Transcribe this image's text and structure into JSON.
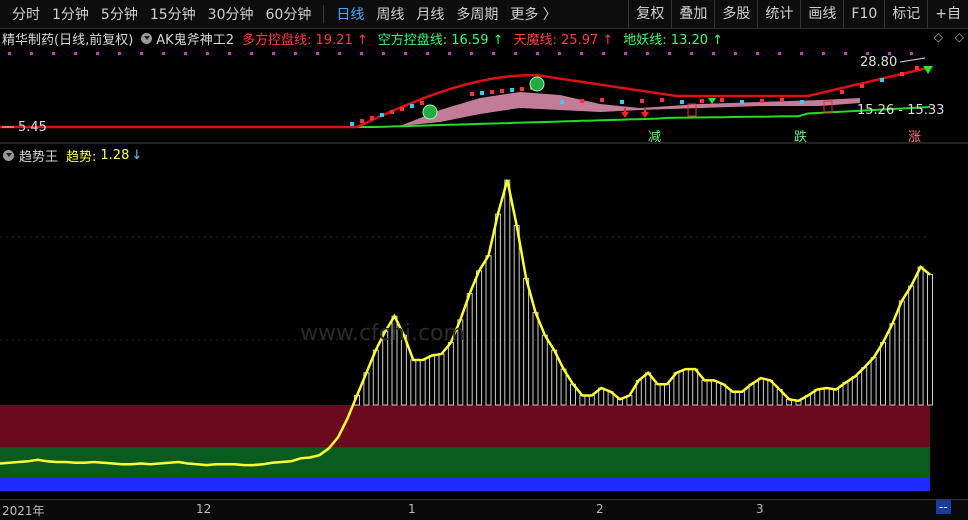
{
  "toolbar": {
    "periods": [
      "分时",
      "1分钟",
      "5分钟",
      "15分钟",
      "30分钟",
      "60分钟",
      "日线",
      "周线",
      "月线",
      "多周期",
      "更多 〉"
    ],
    "active_period": "日线",
    "right_items": [
      "复权",
      "叠加",
      "多股",
      "统计",
      "画线",
      "F10",
      "标记",
      "+自"
    ]
  },
  "main_panel": {
    "stock_label": "精华制药(日线,前复权)",
    "indicator_name": "AK鬼斧神工2",
    "lines": [
      {
        "label": "多方控盘线:",
        "value": "19.21",
        "arrow": "↑",
        "color": "#ff3b3b"
      },
      {
        "label": "空方控盘线:",
        "value": "16.59",
        "arrow": "↑",
        "color": "#33ff66"
      },
      {
        "label": "天魔线:",
        "value": "25.97",
        "arrow": "↑",
        "color": "#ff3b3b"
      },
      {
        "label": "地妖线:",
        "value": "13.20",
        "arrow": "↑",
        "color": "#33ff66"
      }
    ],
    "price_high": "28.80",
    "price_low": "5.45",
    "price_range": "15.26 - 15.33",
    "signal_labels": [
      "减",
      "跌",
      "涨"
    ]
  },
  "sub_panel": {
    "indicator_name": "趋势王",
    "value_label": "趋势:",
    "value": "1.28",
    "arrow": "↓"
  },
  "time_axis": {
    "labels": [
      "2021年",
      "12",
      "1",
      "2",
      "3"
    ],
    "end_marker": "--"
  },
  "chart_data": {
    "type": "line",
    "title": "趋势王",
    "series": [
      {
        "name": "趋势",
        "values": [
          0.35,
          0.36,
          0.37,
          0.38,
          0.4,
          0.38,
          0.37,
          0.37,
          0.36,
          0.36,
          0.37,
          0.36,
          0.35,
          0.34,
          0.34,
          0.35,
          0.34,
          0.35,
          0.36,
          0.37,
          0.35,
          0.34,
          0.33,
          0.34,
          0.34,
          0.34,
          0.33,
          0.33,
          0.34,
          0.36,
          0.37,
          0.38,
          0.42,
          0.43,
          0.46,
          0.55,
          0.7,
          0.95,
          1.25,
          1.55,
          1.85,
          2.1,
          2.3,
          2.05,
          1.72,
          1.72,
          1.78,
          1.8,
          1.95,
          2.25,
          2.6,
          2.9,
          3.1,
          3.65,
          4.1,
          3.5,
          2.8,
          2.35,
          2.05,
          1.85,
          1.6,
          1.4,
          1.25,
          1.25,
          1.35,
          1.3,
          1.2,
          1.25,
          1.45,
          1.55,
          1.4,
          1.4,
          1.55,
          1.6,
          1.6,
          1.45,
          1.45,
          1.4,
          1.3,
          1.3,
          1.4,
          1.48,
          1.45,
          1.33,
          1.2,
          1.18,
          1.25,
          1.33,
          1.35,
          1.33,
          1.42,
          1.5,
          1.62,
          1.75,
          1.95,
          2.2,
          2.5,
          2.7,
          2.95,
          2.85
        ]
      }
    ],
    "ylim": [
      0,
      4.3
    ]
  }
}
